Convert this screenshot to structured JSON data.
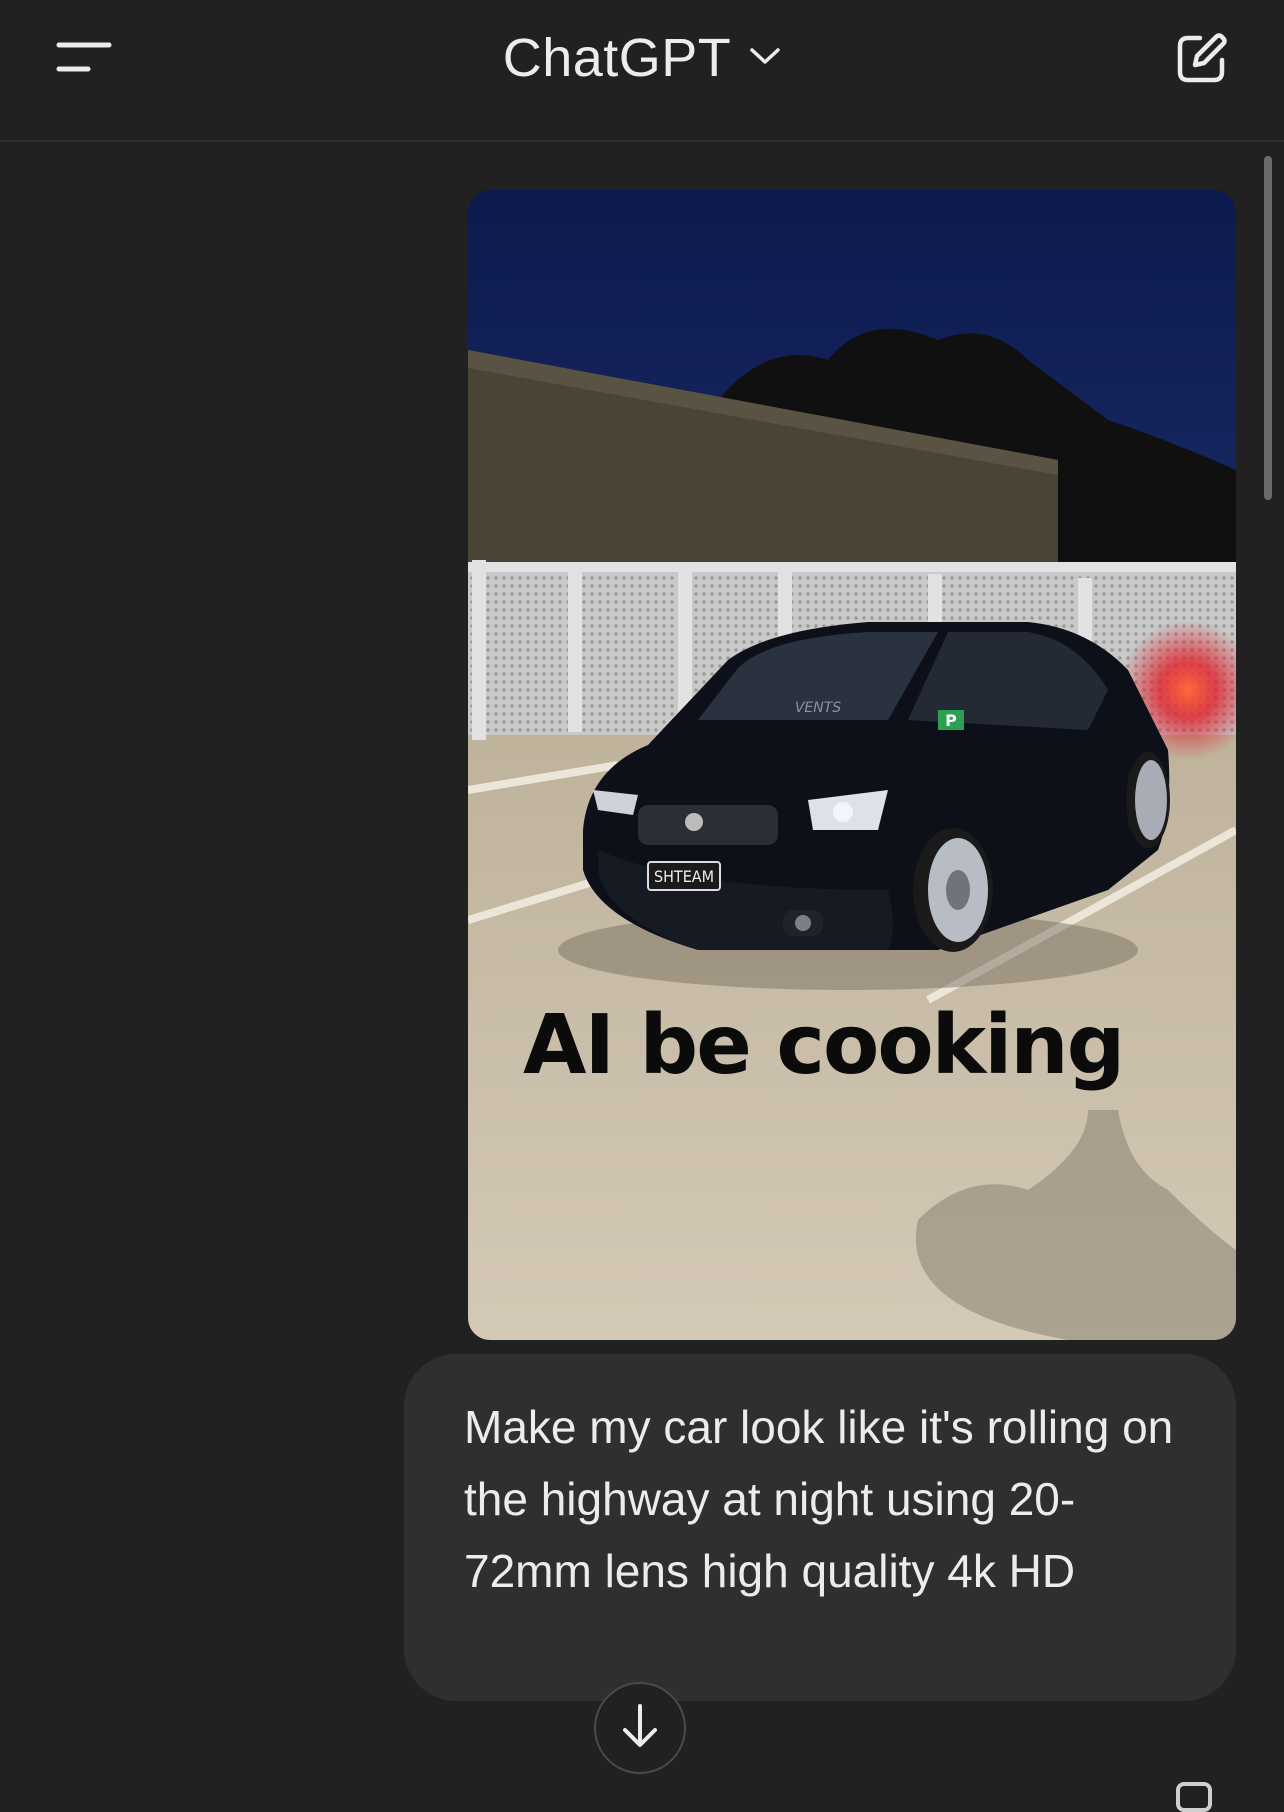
{
  "header": {
    "title": "ChatGPT",
    "menu_icon": "menu-icon",
    "dropdown_icon": "chevron-down-icon",
    "compose_icon": "new-chat-icon"
  },
  "message": {
    "image": {
      "overlay_text": "AI be cooking",
      "plate_text": "SHTEAM",
      "sticker_text": "P",
      "windscreen_text": "VENTS"
    },
    "text": "Make my car look like it's rolling on the highway at night using 20-72mm lens high quality 4k HD"
  },
  "controls": {
    "scroll_down_icon": "arrow-down-icon"
  },
  "colors": {
    "background": "#212121",
    "bubble": "#2f2f2f",
    "text": "#ececec"
  }
}
